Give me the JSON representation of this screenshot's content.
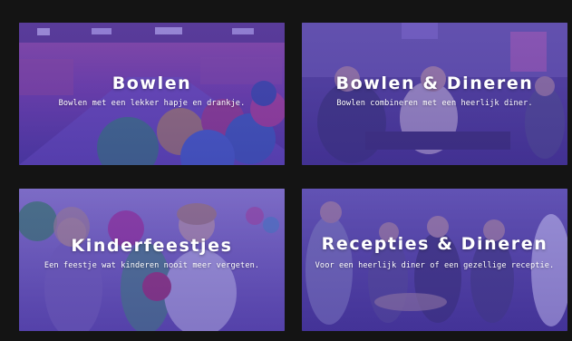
{
  "cards": [
    {
      "title": "Bowlen",
      "subtitle": "Bowlen met een lekker hapje en drankje."
    },
    {
      "title": "Bowlen & Dineren",
      "subtitle": "Bowlen combineren met een heerlijk diner."
    },
    {
      "title": "Kinderfeestjes",
      "subtitle": "Een feestje wat kinderen nooit meer vergeten."
    },
    {
      "title": "Recepties & Dineren",
      "subtitle": "Voor een heerlijk diner of een gezellige receptie."
    }
  ],
  "colors": {
    "background": "#141414",
    "overlay": "#5a46be",
    "text": "#ffffff"
  }
}
